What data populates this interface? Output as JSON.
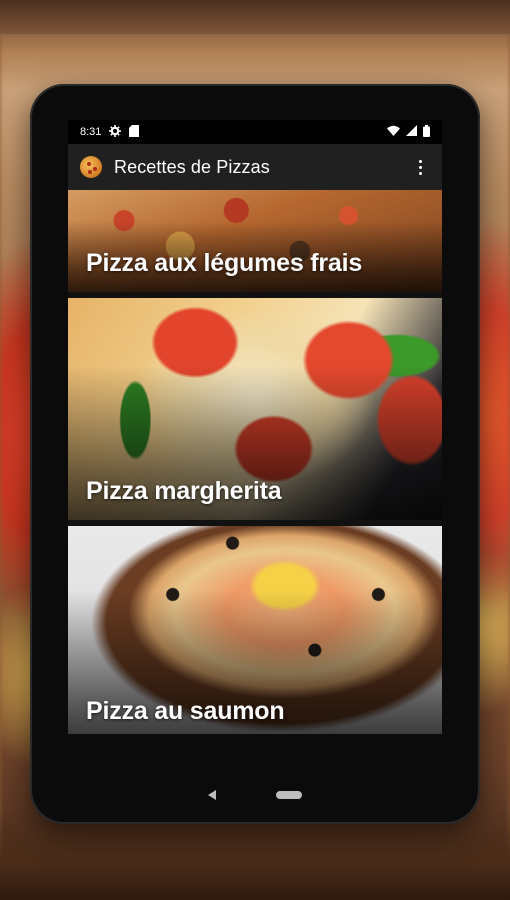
{
  "status_bar": {
    "time": "8:31",
    "icons": [
      "gear-icon",
      "sd-card-icon",
      "wifi-icon",
      "signal-icon",
      "battery-icon"
    ]
  },
  "app_bar": {
    "app_icon": "pizza-icon",
    "title": "Recettes de Pizzas",
    "menu_icon": "overflow-menu-icon"
  },
  "recipes": [
    {
      "label": "Pizza aux légumes frais"
    },
    {
      "label": "Pizza margherita"
    },
    {
      "label": "Pizza au saumon"
    }
  ],
  "nav_bar": {
    "icons": [
      "back-icon",
      "home-icon"
    ]
  }
}
